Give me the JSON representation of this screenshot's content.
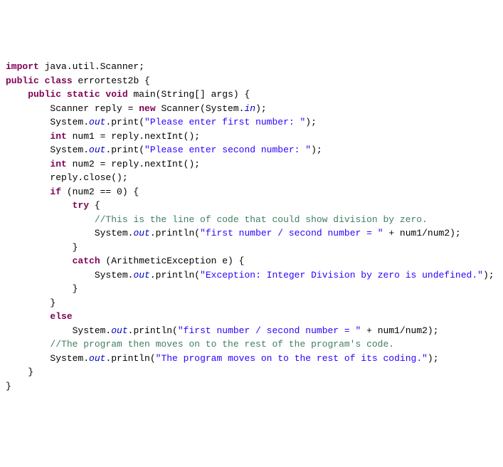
{
  "code": {
    "l1_import": "import",
    "l1_pkg": " java.util.Scanner;",
    "l2": "",
    "l3_public": "public",
    "l3_class": " class",
    "l3_name": " errortest2b {",
    "l4_public": "    public",
    "l4_static": " static",
    "l4_void": " void",
    "l4_rest": " main(String[] args) {",
    "l5_a": "        Scanner reply = ",
    "l5_new": "new",
    "l5_b": " Scanner(System.",
    "l5_in": "in",
    "l5_c": ");",
    "l6_a": "        System.",
    "l6_out": "out",
    "l6_b": ".print(",
    "l6_str": "\"Please enter first number: \"",
    "l6_c": ");",
    "l7_int": "        int",
    "l7_rest": " num1 = reply.nextInt();",
    "l8_a": "        System.",
    "l8_out": "out",
    "l8_b": ".print(",
    "l8_str": "\"Please enter second number: \"",
    "l8_c": ");",
    "l9_int": "        int",
    "l9_rest": " num2 = reply.nextInt();",
    "l10": "        reply.close();",
    "l11_if": "        if",
    "l11_rest": " (num2 == 0) {",
    "l12_try": "            try",
    "l12_rest": " {",
    "l13_comment": "                //This is the line of code that could show division by zero.",
    "l14_a": "                System.",
    "l14_out": "out",
    "l14_b": ".println(",
    "l14_str": "\"first number / second number = \"",
    "l14_c": " + num1/num2);",
    "l15": "            }",
    "l16_catch": "            catch",
    "l16_rest": " (ArithmeticException e) {",
    "l17_a": "                System.",
    "l17_out": "out",
    "l17_b": ".println(",
    "l17_str": "\"Exception: Integer Division by zero is undefined.\"",
    "l17_c": ");",
    "l18": "            }",
    "l19": "        }",
    "l20_else": "        else",
    "l21_a": "            System.",
    "l21_out": "out",
    "l21_b": ".println(",
    "l21_str": "\"first number / second number = \"",
    "l21_c": " + num1/num2);",
    "l22": "",
    "l23_comment": "        //The program then moves on to the rest of the program's code.",
    "l24_a": "        System.",
    "l24_out": "out",
    "l24_b": ".println(",
    "l24_str": "\"The program moves on to the rest of its coding.\"",
    "l24_c": ");",
    "l25": "    }",
    "l26": "}"
  }
}
